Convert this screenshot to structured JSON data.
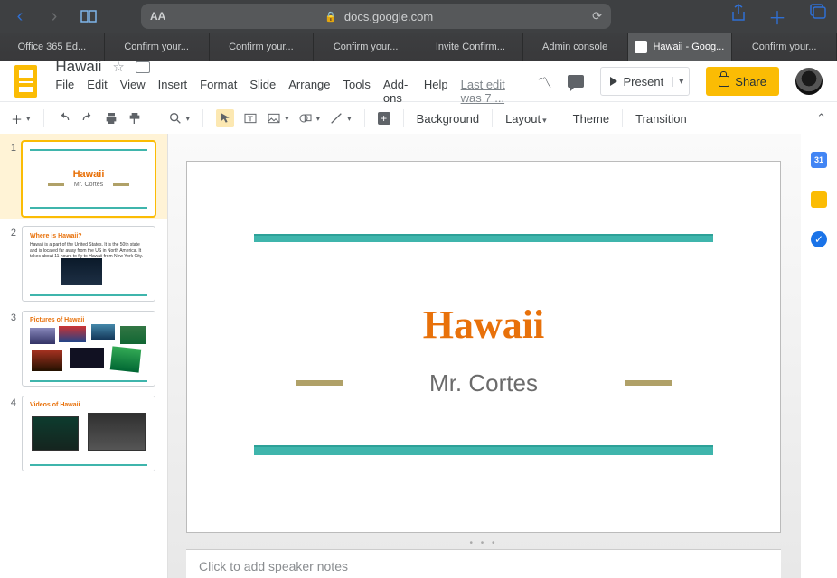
{
  "browser": {
    "url_host": "docs.google.com",
    "tabs": [
      {
        "label": "Office 365 Ed...",
        "active": false
      },
      {
        "label": "Confirm your...",
        "active": false
      },
      {
        "label": "Confirm your...",
        "active": false
      },
      {
        "label": "Confirm your...",
        "active": false
      },
      {
        "label": "Invite Confirm...",
        "active": false
      },
      {
        "label": "Admin console",
        "active": false
      },
      {
        "label": "Hawaii - Goog...",
        "active": true,
        "has_favicon": true
      },
      {
        "label": "Confirm your...",
        "active": false
      }
    ]
  },
  "doc": {
    "title": "Hawaii",
    "menus": [
      "File",
      "Edit",
      "View",
      "Insert",
      "Format",
      "Slide",
      "Arrange",
      "Tools",
      "Add-ons",
      "Help"
    ],
    "last_edit": "Last edit was 7 ...",
    "present_label": "Present",
    "share_label": "Share"
  },
  "toolbar": {
    "background": "Background",
    "layout": "Layout",
    "theme": "Theme",
    "transition": "Transition"
  },
  "thumbs": [
    {
      "num": "1",
      "kind": "title",
      "title": "Hawaii",
      "subtitle": "Mr. Cortes",
      "selected": true
    },
    {
      "num": "2",
      "kind": "text",
      "heading": "Where is Hawaii?"
    },
    {
      "num": "3",
      "kind": "pics",
      "heading": "Pictures of Hawaii"
    },
    {
      "num": "4",
      "kind": "vids",
      "heading": "Videos of Hawaii"
    }
  ],
  "slide": {
    "title": "Hawaii",
    "subtitle": "Mr. Cortes"
  },
  "notes": {
    "placeholder": "Click to add speaker notes"
  },
  "sidepanel": {
    "calendar_day": "31"
  }
}
